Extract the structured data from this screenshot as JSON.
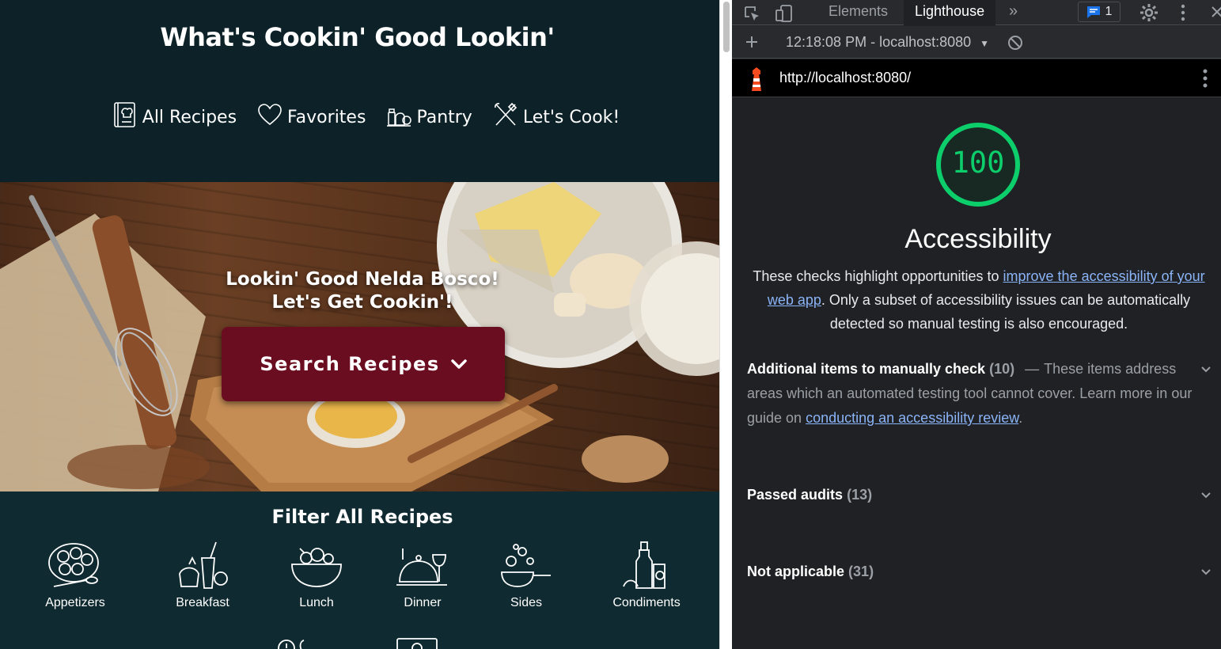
{
  "app": {
    "title": "What's Cookin' Good Lookin'",
    "nav": [
      {
        "label": "All Recipes",
        "icon": "recipe-book-icon"
      },
      {
        "label": "Favorites",
        "icon": "heart-icon"
      },
      {
        "label": "Pantry",
        "icon": "pantry-icon"
      },
      {
        "label": "Let's Cook!",
        "icon": "utensils-icon"
      }
    ],
    "hero": {
      "greeting_line1": "Lookin' Good Nelda Bosco!",
      "greeting_line2": "Let's Get Cookin'!",
      "search_button": "Search Recipes"
    },
    "filter": {
      "title": "Filter All Recipes",
      "categories": [
        {
          "label": "Appetizers",
          "icon": "appetizers-icon"
        },
        {
          "label": "Breakfast",
          "icon": "breakfast-icon"
        },
        {
          "label": "Lunch",
          "icon": "lunch-bowl-icon"
        },
        {
          "label": "Dinner",
          "icon": "dinner-cloche-icon"
        },
        {
          "label": "Sides",
          "icon": "sides-pan-icon"
        },
        {
          "label": "Condiments",
          "icon": "condiments-icon"
        }
      ]
    }
  },
  "devtools": {
    "tabs": [
      {
        "label": "Elements",
        "active": false
      },
      {
        "label": "Lighthouse",
        "active": true
      }
    ],
    "issues_count": "1",
    "report_select": "12:18:08 PM - localhost:8080",
    "url": "http://localhost:8080/",
    "score": "100",
    "score_color": "#0cce6b",
    "category_title": "Accessibility",
    "description": {
      "before": "These checks highlight opportunities to ",
      "link": "improve the accessibility of your web app",
      "after": ". Only a subset of accessibility issues can be automatically detected so manual testing is also encouraged."
    },
    "manual": {
      "title": "Additional items to manually check",
      "count": "(10)",
      "dash": "—",
      "desc": "These items address areas which an automated testing tool cannot cover. Learn more in our guide on ",
      "link": "conducting an accessibility review",
      "end": "."
    },
    "passed": {
      "title": "Passed audits",
      "count": "(13)"
    },
    "not_applicable": {
      "title": "Not applicable",
      "count": "(31)"
    }
  }
}
